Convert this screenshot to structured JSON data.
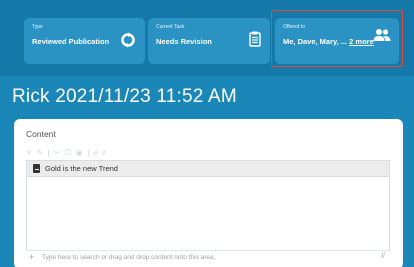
{
  "cards": {
    "type": {
      "label": "Type",
      "value": "Reviewed Publication",
      "icon": "refresh-icon"
    },
    "task": {
      "label": "Current Task",
      "value": "Needs Revision",
      "icon": "clipboard-icon"
    },
    "offered": {
      "label": "Offered to",
      "value": "Me, Dave, Mary, ...",
      "more": "2 more",
      "icon": "users-icon"
    }
  },
  "page": {
    "title": "Rick 2021/11/23 11:52 AM"
  },
  "content": {
    "label": "Content",
    "item": "Gold is the new Trend",
    "drop_hint": "Type here to search or drag and drop content onto this area.",
    "plus": "+"
  },
  "colors": {
    "background": "#1a87b8",
    "card": "#2a93c4",
    "highlight": "#e04a3d"
  }
}
